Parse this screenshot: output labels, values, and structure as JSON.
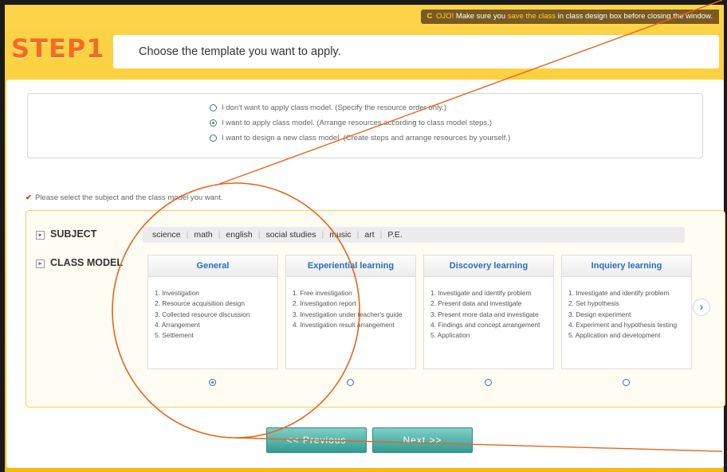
{
  "notice": {
    "icon_label": "C",
    "part1": "OJO!",
    "part2": " Make sure you ",
    "part3": "save the class",
    "part4": " in class design box before closing the window."
  },
  "step": {
    "title": "STEP1",
    "description": "Choose the template you want to apply."
  },
  "apply_options": [
    {
      "label": "I don't want to apply class model. (Specify the resource order only.)",
      "selected": false
    },
    {
      "label": "I want to apply class model. (Arrange resources according to class model steps.)",
      "selected": true
    },
    {
      "label": "I want to design a new class model. (Create steps and arrange resources by yourself.)",
      "selected": false
    }
  ],
  "select_note": "Please select the subject and the class model you want.",
  "subject": {
    "label": "SUBJECT",
    "items": [
      "science",
      "math",
      "english",
      "social studies",
      "music",
      "art",
      "P.E."
    ]
  },
  "class_model": {
    "label": "CLASS MODEL",
    "cards": [
      {
        "title": "General",
        "steps": [
          "1. Investigation",
          "2. Resource acquisition design",
          "3. Collected resource discussion",
          "4. Arrangement",
          "5. Settlement"
        ],
        "selected": true
      },
      {
        "title": "Experiential learning",
        "steps": [
          "1. Free investigation",
          "2. Investigation report",
          "3. Investigation under teacher's guide",
          "4. Investigation result arrangement"
        ],
        "selected": false
      },
      {
        "title": "Discovery learning",
        "steps": [
          "1. Investigate and identify problem",
          "2. Present data and investigate",
          "3. Present more data and investigate",
          "4. Findings and concept arrangement",
          "5. Application"
        ],
        "selected": false
      },
      {
        "title": "Inquiery learning",
        "steps": [
          "1. Investigate and identify problem",
          "2. Set hypothesis",
          "3. Design experiment",
          "4. Experiment and hypothesis testing",
          "5. Application and development"
        ],
        "selected": false
      }
    ],
    "next_icon": "chevron-right-icon"
  },
  "buttons": {
    "previous": "<< Previous",
    "next": "Next >>"
  },
  "colors": {
    "step_title": "#f26c22",
    "card_title": "#2a6dbf",
    "button": "#3aa89d",
    "annotation": "#e8631a"
  }
}
